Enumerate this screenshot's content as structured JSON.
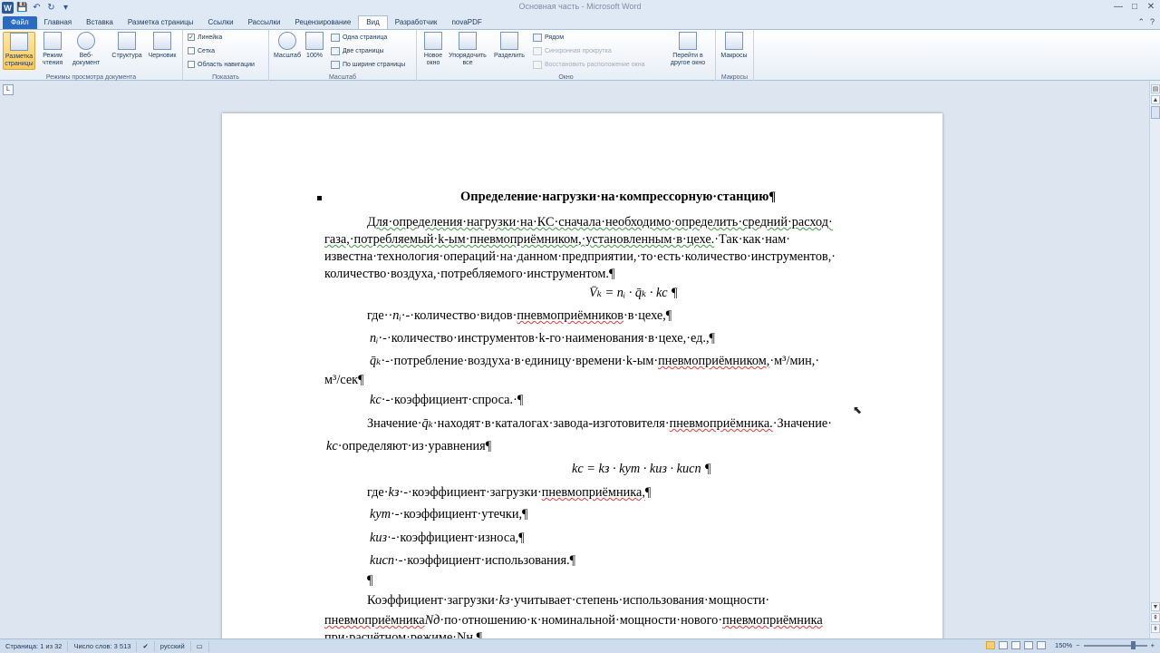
{
  "window": {
    "title": "Основная часть - Microsoft Word",
    "logo": "W",
    "controls": [
      "—",
      "□",
      "✕"
    ]
  },
  "tabs": {
    "file": "Файл",
    "items": [
      "Главная",
      "Вставка",
      "Разметка страницы",
      "Ссылки",
      "Рассылки",
      "Рецензирование",
      "Вид",
      "Разработчик",
      "novaPDF"
    ],
    "active": "Вид"
  },
  "ribbon": {
    "groups": {
      "views": {
        "label": "Режимы просмотра документа",
        "buttons": [
          "Разметка\nстраницы",
          "Режим\nчтения",
          "Веб-документ",
          "Структура",
          "Черновик"
        ]
      },
      "show": {
        "label": "Показать",
        "checks": [
          {
            "label": "Линейка",
            "checked": true
          },
          {
            "label": "Сетка",
            "checked": false
          },
          {
            "label": "Область навигации",
            "checked": false
          }
        ]
      },
      "zoom": {
        "label": "Масштаб",
        "buttons": [
          "Масштаб",
          "100%"
        ],
        "small": [
          "Одна страница",
          "Две страницы",
          "По ширине страницы"
        ]
      },
      "window": {
        "label": "Окно",
        "buttons": [
          "Новое\nокно",
          "Упорядочить\nвсе",
          "Разделить"
        ],
        "small": [
          "Рядом",
          "Синхронная прокрутка",
          "Восстановить расположение окна"
        ],
        "switch": "Перейти в\nдругое окно"
      },
      "macros": {
        "label": "Макросы",
        "button": "Макросы"
      }
    }
  },
  "document": {
    "heading": "Определение·нагрузки·на·компрессорную·станцию¶",
    "lines": {
      "p1_1": "Для·определения·нагрузки·на·КС·сначала·необходимо·определить·средний·расход·",
      "p1_2a": "газа,·потребляемый·k-ым·пневмоприёмником,·установленным·в·цехе.",
      "p1_2b": "·Так·как·нам·",
      "p1_3": "известна·технология·операций·на·данном·предприятии,·то·есть·количество·инструментов,·",
      "p1_4": "количество·воздуха,·потребляемого·инструментом.¶",
      "f1": "V̄ₖ = nᵢ · q̄ₖ · kc ¶",
      "l1a": "где··",
      "l1m": "nᵢ",
      "l1b": "·-·количество·видов·",
      "l1c": "пневмоприёмников",
      "l1d": "·в·цехе,¶",
      "l2m": "nᵢ",
      "l2b": "·-·количество·инструментов·k-го·наименования·в·цехе,·ед.,¶",
      "l3m": "q̄ₖ",
      "l3b": "·-·потребление·воздуха·в·единицу·времени·k-ым·",
      "l3c": "пневмоприёмником,",
      "l3d": "·м³/мин,·",
      "l3e": "м³/сек¶",
      "l4m": "kc",
      "l4b": "·-·коэффициент·спроса.·¶",
      "l5a": "Значение·",
      "l5m": "q̄ₖ",
      "l5b": "·находят·в·каталогах·завода-изготовителя·",
      "l5c": "пневмоприёмника.",
      "l5d": "·Значение·",
      "l6m": "kc",
      "l6b": "·определяют·из·уравнения¶",
      "f2": "kc = kз · kут · kиз · kисп ¶",
      "l7a": "где·",
      "l7m": "kз",
      "l7b": "·-·коэффициент·загрузки·",
      "l7c": "пневмоприёмника,",
      "l7d": "¶",
      "l8m": "kут",
      "l8b": "·-·коэффициент·утечки,¶",
      "l9m": "kиз",
      "l9b": "·-·коэффициент·износа,¶",
      "l10m": "kисп",
      "l10b": "·-·коэффициент·использования.¶",
      "l11": "¶",
      "l12a": "Коэффициент·загрузки·",
      "l12m": "kз",
      "l12b": "·учитывает·степень·использования·мощности·",
      "l13a": "пневмоприёмника",
      "l13m": "Nд",
      "l13b": "·по·отношению·к·номинальной·мощности·нового·",
      "l13c": "пневмоприёмника",
      "l14": "при·расчётном·режиме·Nн.¶"
    }
  },
  "status": {
    "page": "Страница: 1 из 32",
    "words": "Число слов: 3 513",
    "lang": "русский",
    "zoom": "150%",
    "zoom_minus": "−",
    "zoom_plus": "+"
  }
}
